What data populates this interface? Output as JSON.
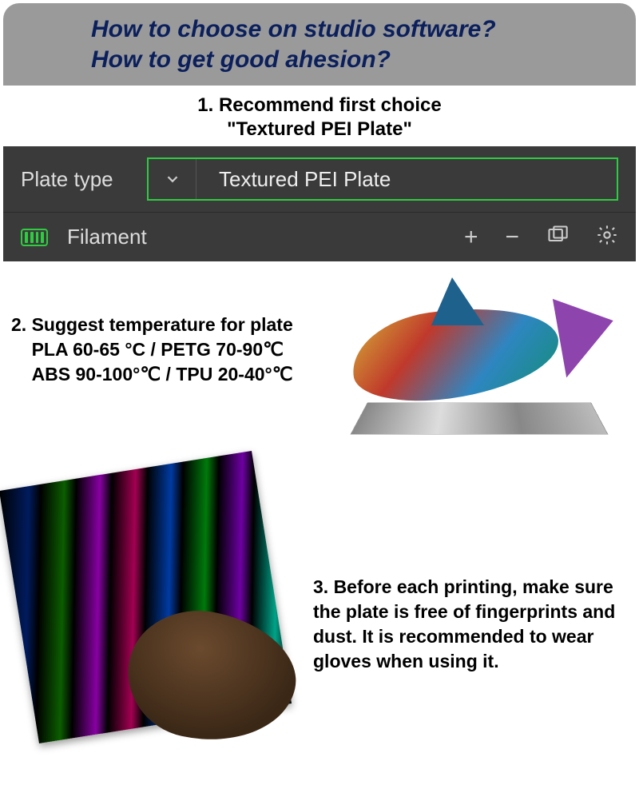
{
  "header": {
    "line1": "How to choose on studio software?",
    "line2": "How to get good ahesion?"
  },
  "step1": {
    "line1": "1. Recommend first choice",
    "line2": "\"Textured PEI Plate\""
  },
  "ui": {
    "plate_type_label": "Plate type",
    "plate_type_value": "Textured PEI Plate",
    "filament_label": "Filament"
  },
  "step2": {
    "line1": "2. Suggest temperature for plate",
    "line2": "PLA 60-65 °C / PETG 70-90℃",
    "line3": "ABS 90-100°℃ / TPU 20-40°℃"
  },
  "step3": {
    "text": "3. Before each printing, make sure the plate is free of fingerprints and dust. It is recommended to wear gloves when using it."
  }
}
